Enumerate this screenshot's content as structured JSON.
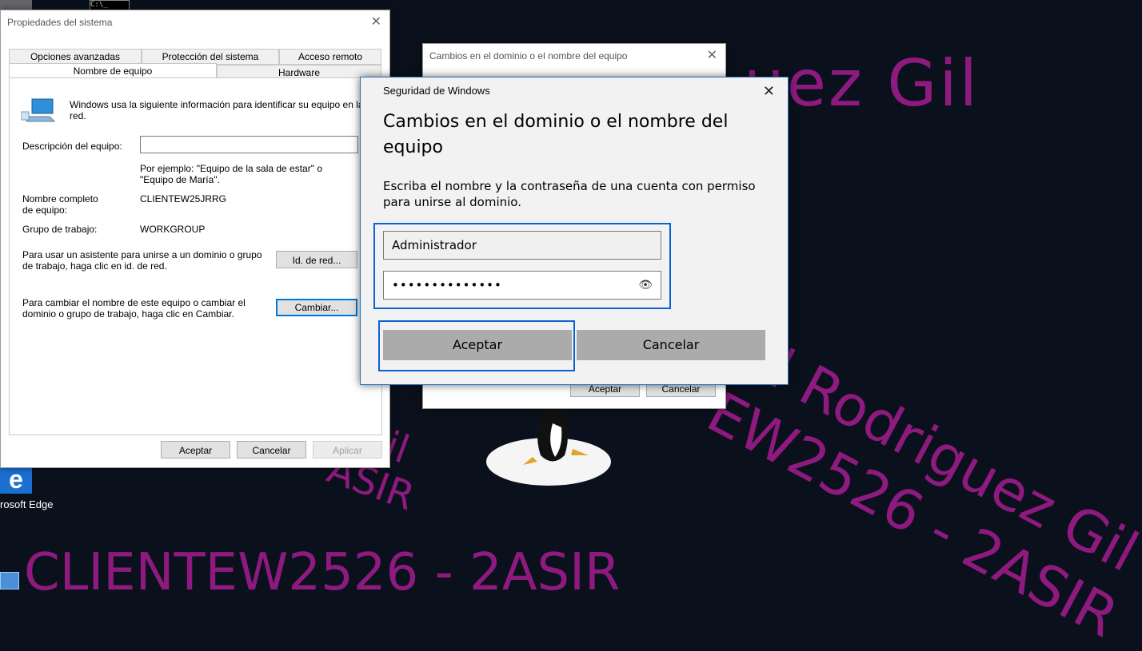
{
  "watermarks": {
    "top": "uez Gil",
    "diag_line1": "ul Rodriguez Gil",
    "diag_line2": "EW2526 - 2ASIR",
    "left_line1": "z Gil",
    "left_line2": "ASIR",
    "bottom": "CLIENTEW2526 - 2ASIR"
  },
  "desktop": {
    "edge_label": "rosoft Edge"
  },
  "system_properties": {
    "title": "Propiedades del sistema",
    "tabs_row1": [
      "Opciones avanzadas",
      "Protección del sistema",
      "Acceso remoto"
    ],
    "tabs_row2": [
      "Nombre de equipo",
      "Hardware"
    ],
    "info_text": "Windows usa la siguiente información para identificar su equipo en la red.",
    "description_label": "Descripción del equipo:",
    "description_value": "",
    "example_text": "Por ejemplo: \"Equipo de la sala de estar\" o \"Equipo de María\".",
    "fullname_label": "Nombre completo de equipo:",
    "fullname_value": "CLIENTEW25JRRG",
    "workgroup_label": "Grupo de trabajo:",
    "workgroup_value": "WORKGROUP",
    "netid_text": "Para usar un asistente para unirse a un dominio o grupo de trabajo, haga clic en id. de red.",
    "netid_button": "Id. de red...",
    "change_text": "Para cambiar el nombre de este equipo o cambiar el dominio o grupo de trabajo, haga clic en Cambiar.",
    "change_button": "Cambiar...",
    "ok_button": "Aceptar",
    "cancel_button": "Cancelar",
    "apply_button": "Aplicar"
  },
  "domain_dialog": {
    "title": "Cambios en el dominio o el nombre del equipo",
    "ok_button": "Aceptar",
    "cancel_button": "Cancelar"
  },
  "security_dialog": {
    "title": "Seguridad de Windows",
    "heading": "Cambios en el dominio o el nombre del equipo",
    "instruction": "Escriba el nombre y la contraseña de una cuenta con permiso para unirse al dominio.",
    "username_value": "Administrador",
    "password_value": "••••••••••••••",
    "ok_button": "Aceptar",
    "cancel_button": "Cancelar"
  }
}
